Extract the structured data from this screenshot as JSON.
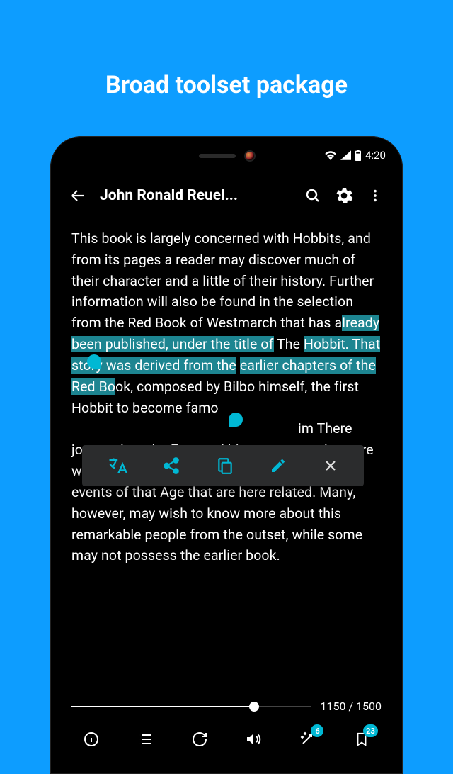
{
  "headline": "Broad toolset package",
  "status": {
    "time": "4:20"
  },
  "appbar": {
    "title": "John Ronald Reuel..."
  },
  "text": {
    "p1a": "This book is largely concerned with Hobbits, and from its pages a reader may discover much of their character and a little of their history. Further information will also be found in the selection from the Red Book of Westmarch that has a",
    "p1h1": "lready been published, under the title of",
    "p1b": " The ",
    "p1h2": "Hobbit. That story was derived from the",
    "p1c": " ",
    "p1h3": "earlier chapters of the Red Bo",
    "p1d": "ok, composed by Bilbo himself, the first Hobbit to become famo",
    "p1e": "im There",
    "p1f": "journey into the East and his return: an adventure which later involved all the Hobbits in the great events of that Age that are here related. Many, however, may wish to know more about this remarkable people from the outset, while some may not possess the earlier book."
  },
  "progress": {
    "current": "1150",
    "sep": " / ",
    "total": "1500"
  },
  "badges": {
    "wand": "6",
    "bookmark": "23"
  }
}
